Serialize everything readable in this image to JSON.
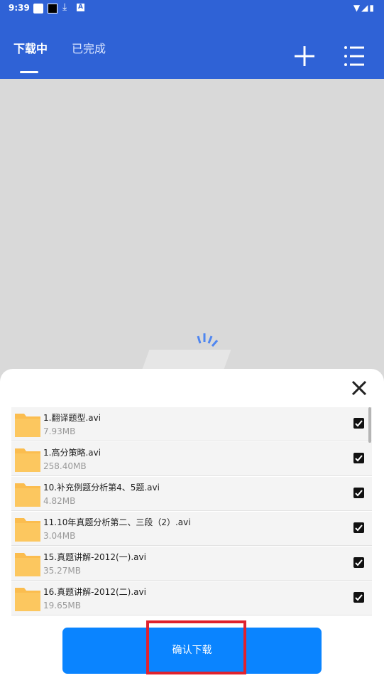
{
  "status_bar": {
    "time": "9:39",
    "icons": [
      "white-square-icon",
      "black-square-icon",
      "download-icon",
      "a-icon",
      "wifi-icon",
      "signal-icon",
      "battery-icon"
    ]
  },
  "header": {
    "tabs": [
      {
        "label": "下载中",
        "active": true
      },
      {
        "label": "已完成",
        "active": false
      }
    ],
    "actions": [
      "plus-icon",
      "menu-list-icon"
    ]
  },
  "dialog": {
    "files": [
      {
        "name": "1.翻译题型.avi",
        "size": "7.93MB",
        "checked": true
      },
      {
        "name": "1.高分策略.avi",
        "size": "258.40MB",
        "checked": true
      },
      {
        "name": "10.补充例题分析第4、5题.avi",
        "size": "4.82MB",
        "checked": true
      },
      {
        "name": "11.10年真题分析第二、三段（2）.avi",
        "size": "3.04MB",
        "checked": true
      },
      {
        "name": "15.真题讲解-2012(一).avi",
        "size": "35.27MB",
        "checked": true
      },
      {
        "name": "16.真题讲解-2012(二).avi",
        "size": "19.65MB",
        "checked": true
      }
    ],
    "confirm_label": "确认下载"
  },
  "colors": {
    "header": "#2f62d6",
    "button": "#0a84ff",
    "folder": "#fbbd4f",
    "highlight": "#e0222e"
  }
}
